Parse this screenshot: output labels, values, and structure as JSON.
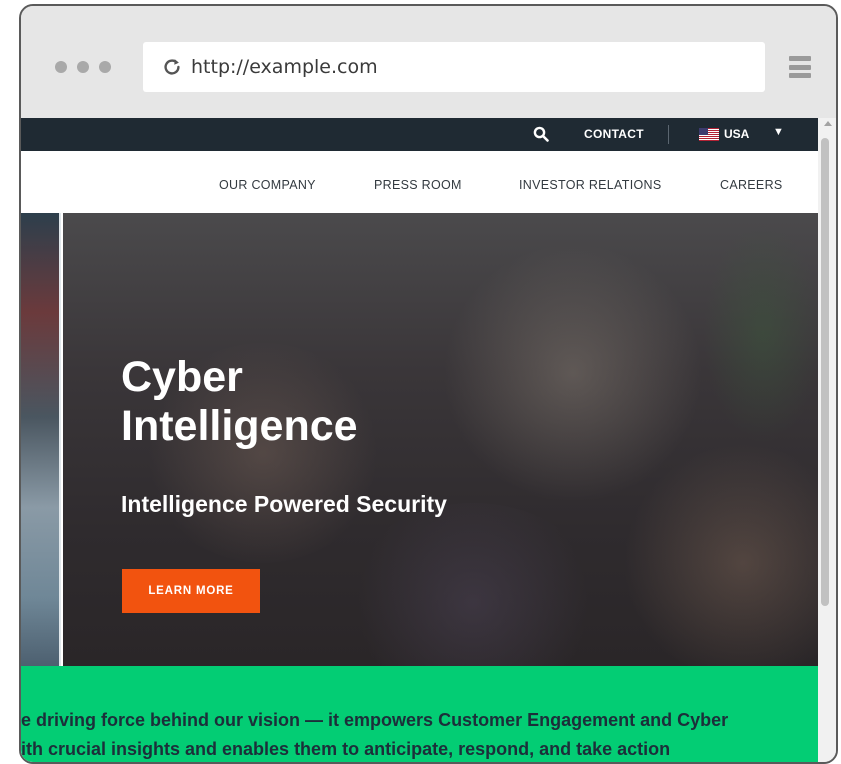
{
  "browser": {
    "url": "http://example.com",
    "icons": {
      "reload": "reload-icon",
      "menu": "hamburger-menu-icon"
    }
  },
  "topbar": {
    "contact_label": "CONTACT",
    "country_label": "USA",
    "icons": {
      "search": "search-icon",
      "flag": "us-flag-icon",
      "caret": "dropdown-caret-icon"
    }
  },
  "nav": {
    "items": [
      {
        "label": "OUR COMPANY"
      },
      {
        "label": "PRESS ROOM"
      },
      {
        "label": "INVESTOR RELATIONS"
      },
      {
        "label": "CAREERS"
      }
    ]
  },
  "hero": {
    "title_line1": "Cyber",
    "title_line2": "Intelligence",
    "subtitle": "Intelligence Powered Security",
    "cta_label": "LEARN MORE"
  },
  "mission": {
    "line1": "e driving force behind our vision — it empowers Customer Engagement and Cyber",
    "line2": "ith crucial insights and enables them to anticipate, respond, and take action"
  },
  "colors": {
    "topbar_bg": "#1f2a33",
    "cta_orange": "#f2530f",
    "band_green": "#03cd74"
  }
}
